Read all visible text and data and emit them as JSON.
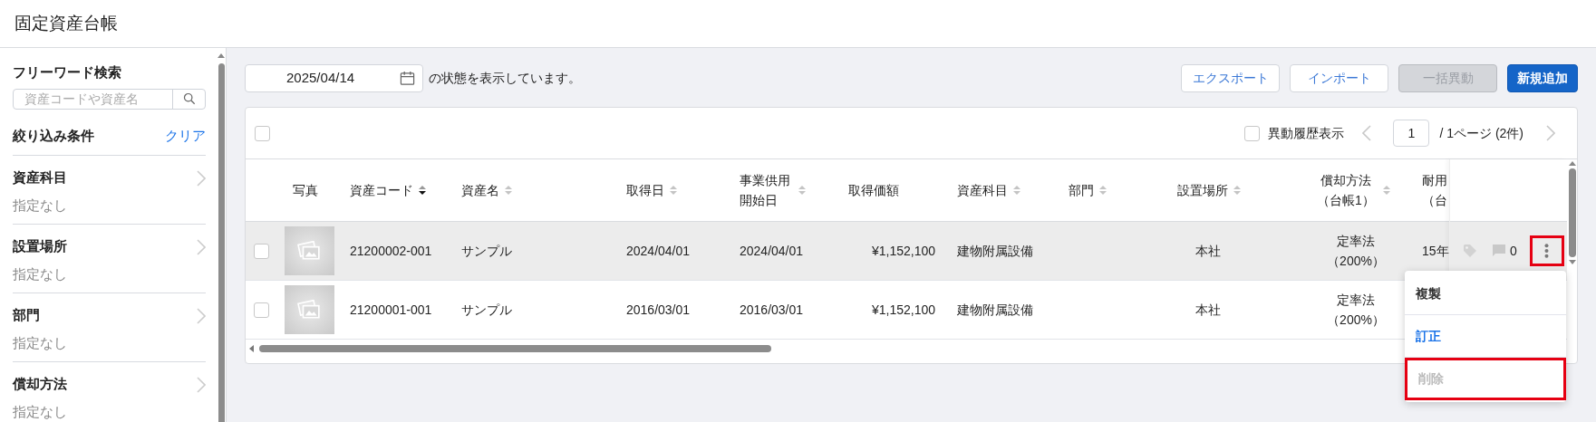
{
  "page": {
    "title": "固定資産台帳"
  },
  "sidebar": {
    "search": {
      "heading": "フリーワード検索",
      "placeholder": "資産コードや資産名"
    },
    "filter": {
      "heading": "絞り込み条件",
      "clear": "クリア"
    },
    "filters": [
      {
        "label": "資産科目",
        "value": "指定なし"
      },
      {
        "label": "設置場所",
        "value": "指定なし"
      },
      {
        "label": "部門",
        "value": "指定なし"
      },
      {
        "label": "償却方法",
        "value": "指定なし"
      }
    ]
  },
  "toolbar": {
    "date": "2025/04/14",
    "caption": "の状態を表示しています。",
    "buttons": [
      {
        "label": "エクスポート",
        "kind": "outline",
        "disabled": false
      },
      {
        "label": "インポート",
        "kind": "outline",
        "disabled": false
      },
      {
        "label": "一括異動",
        "kind": "outline",
        "disabled": true
      },
      {
        "label": "新規追加",
        "kind": "primary",
        "disabled": false
      }
    ]
  },
  "table": {
    "select_all": {
      "checked": false
    },
    "history_toggle": {
      "label": "異動履歴表示",
      "checked": false
    },
    "page": "1",
    "page_total": "/ 1ページ (2件)",
    "columns": [
      {
        "label": "写真",
        "sortable": false
      },
      {
        "label": "資産コード",
        "sortable": true,
        "sorted": true
      },
      {
        "label": "資産名",
        "sortable": true,
        "sorted": false
      },
      {
        "label": "取得日",
        "sortable": true,
        "sorted": false
      },
      {
        "label": "事業供用開始日",
        "sortable": true,
        "sorted": false
      },
      {
        "label": "取得価額",
        "sortable": false
      },
      {
        "label": "資産科目",
        "sortable": true,
        "sorted": false
      },
      {
        "label": "部門",
        "sortable": true,
        "sorted": false
      },
      {
        "label": "設置場所",
        "sortable": true,
        "sorted": false
      },
      {
        "label": "償却方法（台帳1）",
        "sortable": true,
        "sorted": false
      },
      {
        "label": "耐用（台",
        "sortable": false
      }
    ],
    "rows": [
      {
        "checked": false,
        "highlighted": true,
        "cells": [
          {
            "kind": "photo"
          },
          {
            "kind": "text",
            "text": "21200002-001"
          },
          {
            "kind": "text",
            "text": "サンプル"
          },
          {
            "kind": "text",
            "text": "2024/04/01"
          },
          {
            "kind": "text",
            "text": "2024/04/01"
          },
          {
            "kind": "text",
            "text": "¥1,152,100"
          },
          {
            "kind": "text",
            "text": "建物附属設備"
          },
          {
            "kind": "text",
            "text": ""
          },
          {
            "kind": "text",
            "text": "本社"
          },
          {
            "kind": "text",
            "text": "定率法（200%）"
          },
          {
            "kind": "text",
            "text": "15年"
          }
        ],
        "actions": {
          "comments": "0",
          "menu_highlighted": true
        }
      },
      {
        "checked": false,
        "highlighted": false,
        "cells": [
          {
            "kind": "photo"
          },
          {
            "kind": "text",
            "text": "21200001-001"
          },
          {
            "kind": "text",
            "text": "サンプル"
          },
          {
            "kind": "text",
            "text": "2016/03/01"
          },
          {
            "kind": "text",
            "text": "2016/03/01"
          },
          {
            "kind": "text",
            "text": "¥1,152,100"
          },
          {
            "kind": "text",
            "text": "建物附属設備"
          },
          {
            "kind": "text",
            "text": ""
          },
          {
            "kind": "text",
            "text": "本社"
          },
          {
            "kind": "text",
            "text": "定率法（200%）"
          }
        ]
      }
    ],
    "menu": [
      {
        "label": "複製",
        "kind": "plain",
        "disabled": false,
        "highlighted": false
      },
      {
        "label": "訂正",
        "kind": "link",
        "disabled": false,
        "highlighted": false
      },
      {
        "label": "削除",
        "kind": "plain",
        "disabled": true,
        "highlighted": true
      }
    ]
  }
}
